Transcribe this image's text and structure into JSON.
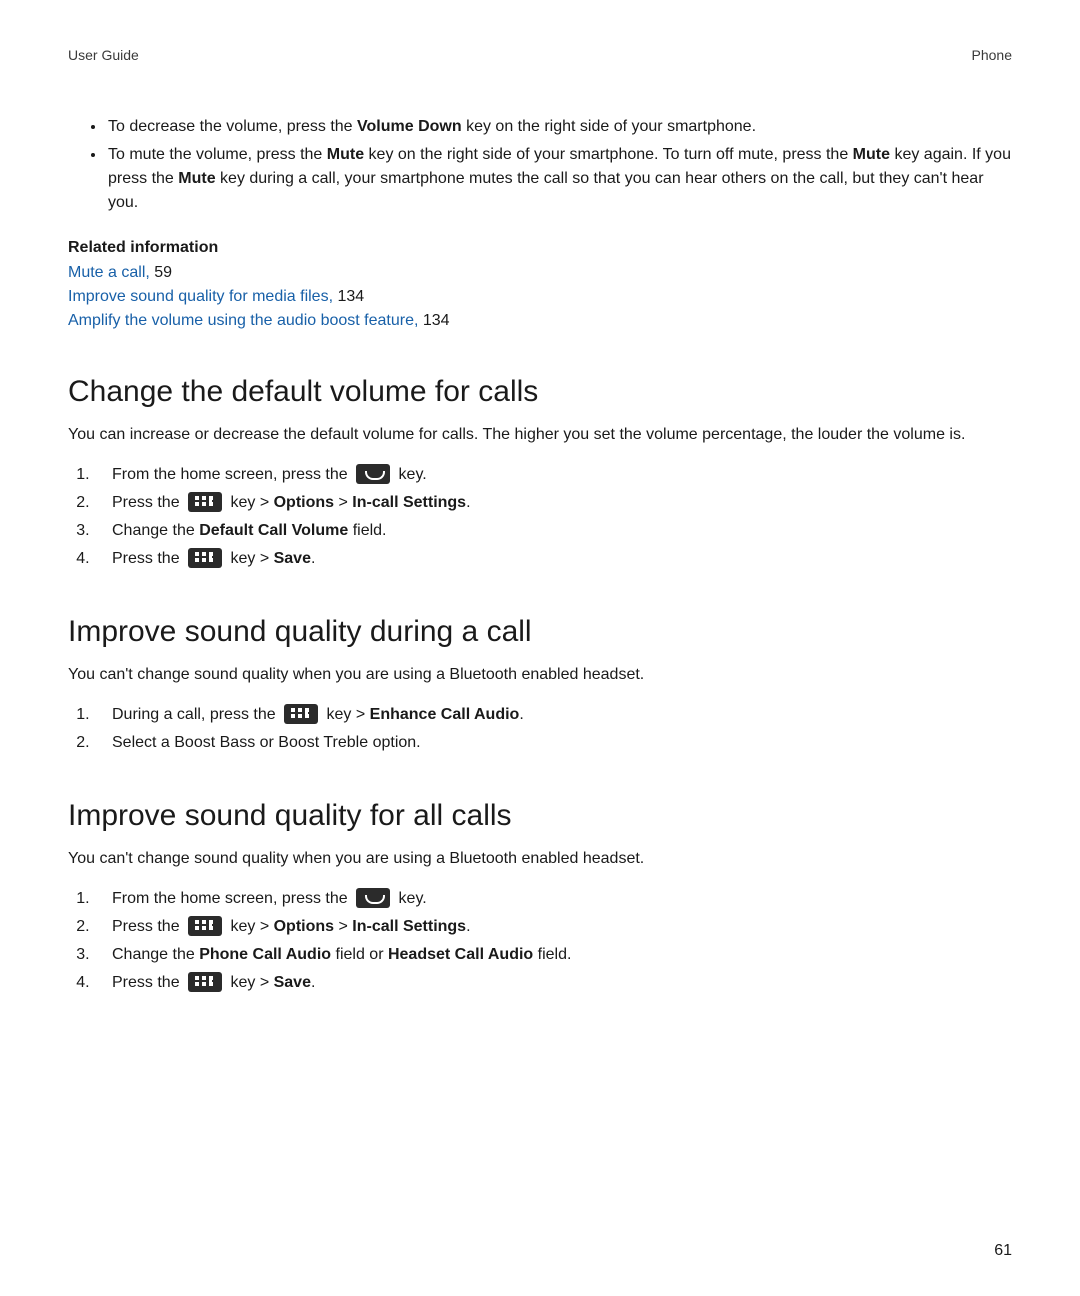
{
  "header": {
    "left": "User Guide",
    "right": "Phone"
  },
  "bullets": {
    "b1": {
      "pre": "To decrease the volume, press the ",
      "bold1": "Volume Down",
      "post1": " key on the right side of your smartphone."
    },
    "b2": {
      "pre": "To mute the volume, press the ",
      "bold1": "Mute",
      "mid1": " key on the right side of your smartphone. To turn off mute, press the ",
      "bold2": "Mute",
      "mid2": " key again. If you press the ",
      "bold3": "Mute",
      "post": " key during a call, your smartphone mutes the call so that you can hear others on the call, but they can't hear you."
    }
  },
  "related": {
    "heading": "Related information",
    "items": [
      {
        "link": "Mute a call,",
        "page": " 59"
      },
      {
        "link": "Improve sound quality for media files,",
        "page": " 134"
      },
      {
        "link": "Amplify the volume using the audio boost feature,",
        "page": " 134"
      }
    ]
  },
  "section1": {
    "title": "Change the default volume for calls",
    "para": "You can increase or decrease the default volume for calls. The higher you set the volume percentage, the louder the volume is.",
    "steps": {
      "s1": {
        "pre": "From the home screen, press the ",
        "post": " key."
      },
      "s2": {
        "pre": "Press the ",
        "mid": " key > ",
        "bold1": "Options",
        "sep": " > ",
        "bold2": "In-call Settings",
        "end": "."
      },
      "s3": {
        "pre": "Change the ",
        "bold1": "Default Call Volume",
        "post": " field."
      },
      "s4": {
        "pre": "Press the ",
        "mid": " key > ",
        "bold1": "Save",
        "end": "."
      }
    }
  },
  "section2": {
    "title": "Improve sound quality during a call",
    "para": "You can't change sound quality when you are using a Bluetooth enabled headset.",
    "steps": {
      "s1": {
        "pre": "During a call, press the ",
        "mid": " key > ",
        "bold1": "Enhance Call Audio",
        "end": "."
      },
      "s2": {
        "text": "Select a Boost Bass or Boost Treble option."
      }
    }
  },
  "section3": {
    "title": "Improve sound quality for all calls",
    "para": "You can't change sound quality when you are using a Bluetooth enabled headset.",
    "steps": {
      "s1": {
        "pre": "From the home screen, press the ",
        "post": " key."
      },
      "s2": {
        "pre": "Press the ",
        "mid": " key > ",
        "bold1": "Options",
        "sep": " > ",
        "bold2": "In-call Settings",
        "end": "."
      },
      "s3": {
        "pre": "Change the ",
        "bold1": "Phone Call Audio",
        "mid": " field or ",
        "bold2": "Headset Call Audio",
        "post": " field."
      },
      "s4": {
        "pre": "Press the ",
        "mid": " key > ",
        "bold1": "Save",
        "end": "."
      }
    }
  },
  "pageNumber": "61"
}
